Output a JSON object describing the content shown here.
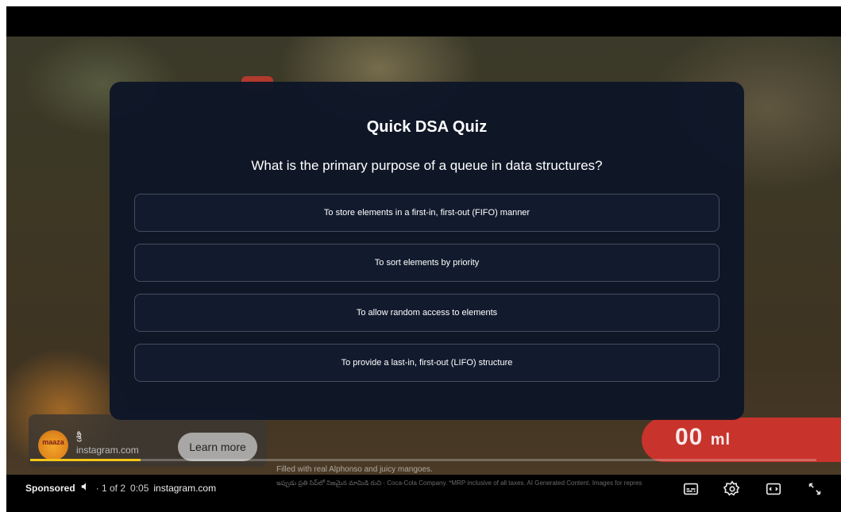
{
  "quiz": {
    "title": "Quick DSA Quiz",
    "question": "What is the primary purpose of a queue in data structures?",
    "options": [
      "To store elements in a first-in, first-out (FIFO) manner",
      "To sort elements by priority",
      "To allow random access to elements",
      "To provide a last-in, first-out (LIFO) structure"
    ]
  },
  "video": {
    "banner_text": "00",
    "banner_unit": "ml",
    "caption_text": "Filled with real Alphonso and juicy mangoes.",
    "caption_small": "ఇప్పుడు ప్రతి సిప్‌లో నిజమైన మామిడి రుచి · Coca-Cola Company. *MRP inclusive of all taxes. AI Generated Content. Images for representation purpose only."
  },
  "ad": {
    "logo_text": "maaza",
    "title": "శ్రీ",
    "domain": "instagram.com",
    "cta_label": "Learn more"
  },
  "progress": {
    "fraction": 0.14
  },
  "controls": {
    "sponsored_label": "Sponsored",
    "ad_count": "· 1 of 2",
    "time": "0:05",
    "domain": "instagram.com"
  },
  "colors": {
    "overlay": "#0e1628",
    "progress": "#f5c518",
    "banner": "#c8332c"
  }
}
